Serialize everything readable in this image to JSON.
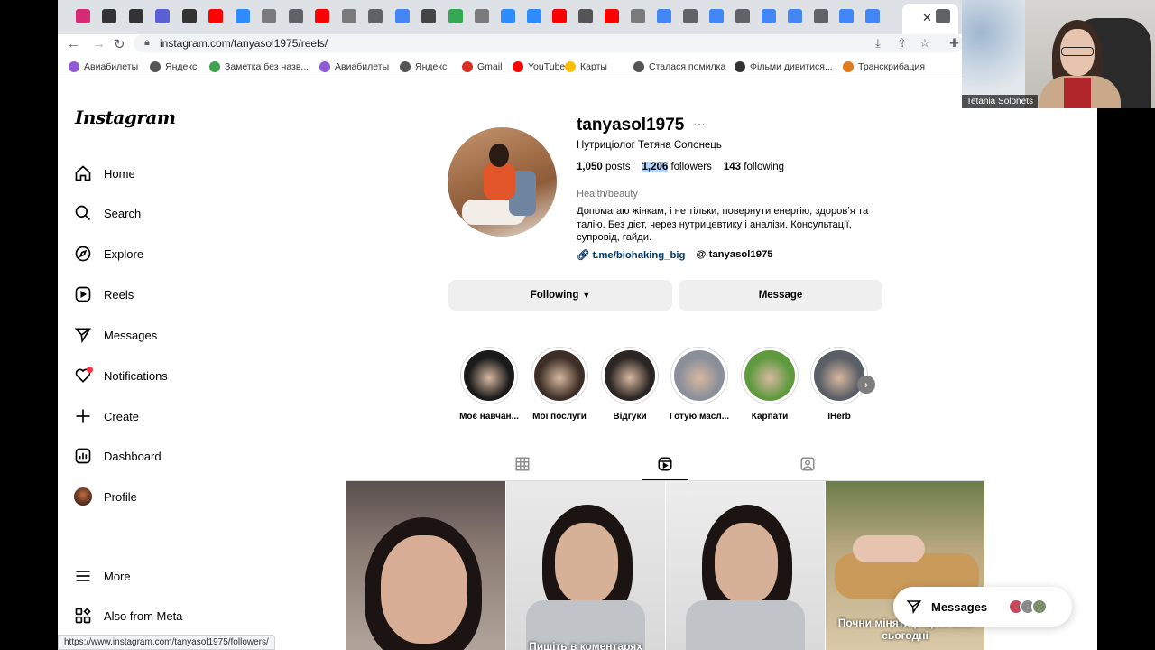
{
  "browser": {
    "url": "instagram.com/tanyasol1975/reels/",
    "status_url": "https://www.instagram.com/tanyasol1975/followers/",
    "close_glyph": "✕",
    "tabs": [
      {
        "icon": "instagram-icon",
        "color": "#d62976"
      },
      {
        "icon": "k-icon",
        "color": "#333"
      },
      {
        "icon": "k-icon",
        "color": "#333"
      },
      {
        "icon": "doc-icon",
        "color": "#5a5fd6"
      },
      {
        "icon": "k-icon",
        "color": "#333"
      },
      {
        "icon": "youtube-icon",
        "color": "#ff0000"
      },
      {
        "icon": "zoom-icon",
        "color": "#2d8cff"
      },
      {
        "icon": "t-icon",
        "color": "#7a7a7a"
      },
      {
        "icon": "globe-icon",
        "color": "#5f6368"
      },
      {
        "icon": "youtube-icon",
        "color": "#ff0000"
      },
      {
        "icon": "t-icon",
        "color": "#7a7a7a"
      },
      {
        "icon": "globe-icon",
        "color": "#5f6368"
      },
      {
        "icon": "docs-icon",
        "color": "#4285f4"
      },
      {
        "icon": "chatgpt-icon",
        "color": "#444"
      },
      {
        "icon": "sheets-plus-icon",
        "color": "#34a853"
      },
      {
        "icon": "t-icon",
        "color": "#7a7a7a"
      },
      {
        "icon": "zoom-icon",
        "color": "#2d8cff"
      },
      {
        "icon": "zoom-icon",
        "color": "#2d8cff"
      },
      {
        "icon": "youtube-icon",
        "color": "#ff0000"
      },
      {
        "icon": "trident-icon",
        "color": "#555"
      },
      {
        "icon": "youtube-icon",
        "color": "#ff0000"
      },
      {
        "icon": "t-icon",
        "color": "#7a7a7a"
      },
      {
        "icon": "docs-icon",
        "color": "#4285f4"
      },
      {
        "icon": "globe-icon",
        "color": "#5f6368"
      },
      {
        "icon": "docs-icon",
        "color": "#4285f4"
      },
      {
        "icon": "globe-icon",
        "color": "#5f6368"
      },
      {
        "icon": "docs-icon",
        "color": "#4285f4"
      },
      {
        "icon": "docs-icon",
        "color": "#4285f4"
      },
      {
        "icon": "globe-icon",
        "color": "#5f6368"
      },
      {
        "icon": "docs-icon",
        "color": "#4285f4"
      },
      {
        "icon": "docs-icon",
        "color": "#4285f4"
      }
    ],
    "bookmarks": [
      {
        "label": "Авиабилеты",
        "color": "#8e5ad6"
      },
      {
        "label": "Яндекс",
        "color": "#555"
      },
      {
        "label": "Заметка без назв...",
        "color": "#3fa34d"
      },
      {
        "label": "Авиабилеты",
        "color": "#8e5ad6"
      },
      {
        "label": "Яндекс",
        "color": "#555"
      },
      {
        "label": "Gmail",
        "color": "#d93025"
      },
      {
        "label": "YouTube",
        "color": "#ff0000"
      },
      {
        "label": "Карты",
        "color": "#fbbc04"
      },
      {
        "label": "Сталася помилка",
        "color": "#555"
      },
      {
        "label": "Фільми дивитися...",
        "color": "#333"
      },
      {
        "label": "Транскрибация",
        "color": "#e07a1f"
      }
    ]
  },
  "sidebar": {
    "logo": "Instagram",
    "items": [
      {
        "label": "Home",
        "icon": "home-icon"
      },
      {
        "label": "Search",
        "icon": "search-icon"
      },
      {
        "label": "Explore",
        "icon": "compass-icon"
      },
      {
        "label": "Reels",
        "icon": "reels-icon"
      },
      {
        "label": "Messages",
        "icon": "paper-plane-icon"
      },
      {
        "label": "Notifications",
        "icon": "heart-icon"
      },
      {
        "label": "Create",
        "icon": "plus-icon"
      },
      {
        "label": "Dashboard",
        "icon": "dashboard-icon"
      },
      {
        "label": "Profile",
        "icon": "avatar"
      }
    ],
    "more": "More",
    "meta": "Also from Meta"
  },
  "profile": {
    "username": "tanyasol1975",
    "more_glyph": "···",
    "full_name": "Нутриціолог Тетяна Солонець",
    "posts_count": "1,050",
    "posts_label": "posts",
    "followers_count": "1,206",
    "followers_label": "followers",
    "following_count": "143",
    "following_label": "following",
    "category": "Health/beauty",
    "bio": "Допомагаю жінкам, і не тільки, повернути енергію, здоровʼя та талію. Без дієт, через нутрицевтику і аналізи. Консультації, супровід, гайди.",
    "link": "t.me/biohaking_big",
    "threads": "tanyasol1975",
    "following_button": "Following",
    "message_button": "Message"
  },
  "highlights": [
    {
      "label": "Моє навчан...",
      "color": "#1a1a1a"
    },
    {
      "label": "Мої послуги",
      "color": "#3d2f27"
    },
    {
      "label": "Відгуки",
      "color": "#2b2523"
    },
    {
      "label": "Готую масл...",
      "color": "#8a8f9a"
    },
    {
      "label": "Карпати",
      "color": "#5f9a3f"
    },
    {
      "label": "IHerb",
      "color": "#5a5e66"
    }
  ],
  "highlight_next_glyph": "›",
  "grid": {
    "captions": [
      "",
      "Пишіть в коментарях",
      "",
      "Почни міняти раціон вже сьогодні"
    ]
  },
  "messages_pill": {
    "label": "Messages"
  },
  "webcam": {
    "name": "Tetania Solonets"
  },
  "colors": {
    "link": "#00376b",
    "notification_dot": "#ff3040",
    "selection": "#b3d4fc"
  }
}
